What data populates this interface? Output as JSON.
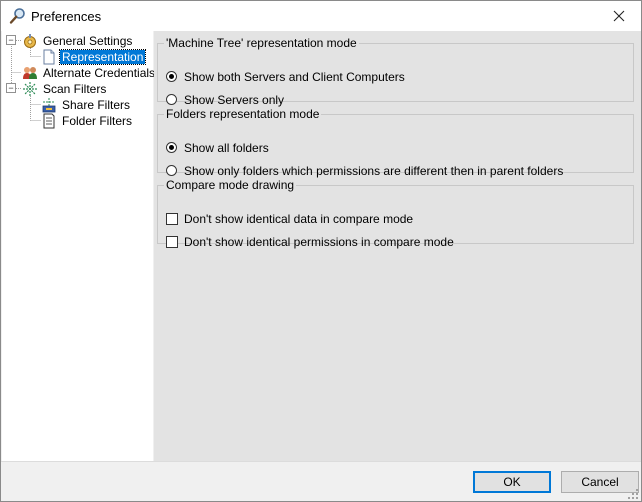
{
  "window": {
    "title": "Preferences"
  },
  "tree": {
    "items": [
      {
        "label": "General Settings",
        "icon": "settings-gear-icon"
      },
      {
        "label": "Representation",
        "icon": "document-icon",
        "selected": true
      },
      {
        "label": "Alternate Credentials",
        "icon": "users-icon"
      },
      {
        "label": "Scan Filters",
        "icon": "filter-network-icon"
      },
      {
        "label": "Share Filters",
        "icon": "share-filter-icon"
      },
      {
        "label": "Folder Filters",
        "icon": "folder-filter-icon"
      }
    ]
  },
  "groups": {
    "machine_tree": {
      "title": "'Machine Tree' representation mode",
      "options": [
        {
          "label": "Show both Servers and Client Computers",
          "checked": true
        },
        {
          "label": "Show Servers only",
          "checked": false
        }
      ]
    },
    "folders": {
      "title": "Folders representation mode",
      "options": [
        {
          "label": "Show all folders",
          "checked": true
        },
        {
          "label": "Show only folders which permissions are different then in parent folders",
          "checked": false
        }
      ]
    },
    "compare": {
      "title": "Compare mode drawing",
      "options": [
        {
          "label": "Don't show identical data in compare mode",
          "checked": false
        },
        {
          "label": "Don't show identical permissions in compare mode",
          "checked": false
        }
      ]
    }
  },
  "footer": {
    "ok_label": "OK",
    "cancel_label": "Cancel"
  },
  "colors": {
    "selection": "#0078d7",
    "content_bg": "#e3e3e3"
  }
}
